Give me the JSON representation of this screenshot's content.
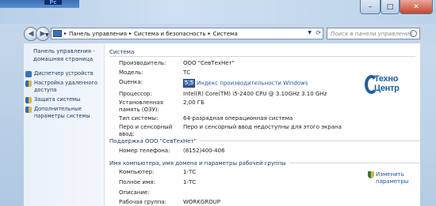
{
  "taskbar": {
    "app_label": "Pc"
  },
  "window": {
    "min_label": "–",
    "max_label": "□",
    "close_label": "✕"
  },
  "nav": {
    "breadcrumbs": [
      "Панель управления",
      "Система и безопасность",
      "Система"
    ],
    "search_placeholder": "Поиск в панели управления"
  },
  "sidebar": {
    "home": "Панель управления - домашняя страница",
    "items": [
      {
        "label": "Диспетчер устройств",
        "icon": "device-manager-icon",
        "color": "#3b73b9"
      },
      {
        "label": "Настройка удаленного доступа",
        "icon": "shield-icon",
        "color": "#4a7fbf"
      },
      {
        "label": "Защита системы",
        "icon": "shield-icon",
        "color": "#4a7fbf"
      },
      {
        "label": "Дополнительные параметры системы",
        "icon": "shield-icon",
        "color": "#4a7fbf"
      }
    ]
  },
  "system": {
    "heading": "Система",
    "rows": [
      {
        "label": "Производитель:",
        "value": "ООО \"СевТехНет\""
      },
      {
        "label": "Модель:",
        "value": "ТС"
      },
      {
        "label": "Оценка:",
        "score": "5,5",
        "value": "Индекс производительности Windows"
      },
      {
        "label": "Процессор:",
        "value": "Intel(R) Core(TM) i5-2400 CPU @ 3.10GHz   3.10 GHz"
      },
      {
        "label": "Установленная память (ОЗУ):",
        "value": "2,00 ГБ"
      },
      {
        "label": "Тип системы:",
        "value": "64-разрядная операционная система"
      },
      {
        "label": "Перо и сенсорный ввод:",
        "value": "Перо и сенсорный ввод недоступны для этого экрана"
      }
    ],
    "logo": {
      "line1": "Техно",
      "line2": "Центр"
    }
  },
  "support": {
    "heading": "Поддержка ООО \"СевТехНет\"",
    "rows": [
      {
        "label": "Номер телефона:",
        "value": "(8152)400-406"
      }
    ]
  },
  "computer": {
    "heading": "Имя компьютера, имя домена и параметры рабочей группы",
    "change_link": "Изменить параметры",
    "rows": [
      {
        "label": "Компьютер:",
        "value": "1-ТС"
      },
      {
        "label": "Полное имя:",
        "value": "1-ТС"
      },
      {
        "label": "Описание:",
        "value": ""
      },
      {
        "label": "Рабочая группа:",
        "value": "WORKGROUP"
      }
    ]
  }
}
